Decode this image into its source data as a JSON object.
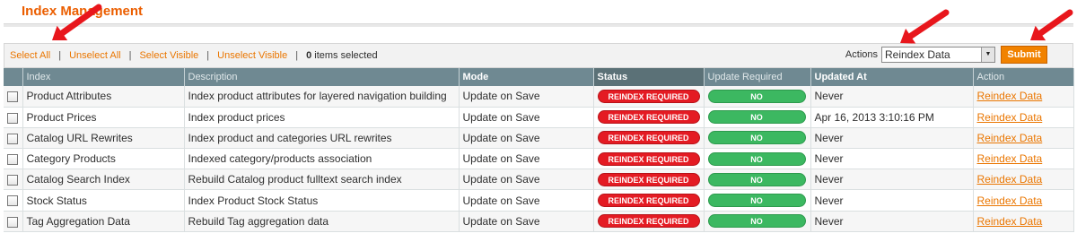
{
  "page": {
    "title": "Index Management"
  },
  "massaction": {
    "select_all": "Select All",
    "unselect_all": "Unselect All",
    "select_visible": "Select Visible",
    "unselect_visible": "Unselect Visible",
    "separator": "|",
    "count": "0",
    "count_suffix": " items selected",
    "actions_label": "Actions",
    "action_selected": "Reindex Data",
    "submit_label": "Submit"
  },
  "grid": {
    "headers": [
      "Index",
      "Description",
      "Mode",
      "Status",
      "Update Required",
      "Updated At",
      "Action"
    ],
    "rows": [
      {
        "index": "Product Attributes",
        "description": "Index product attributes for layered navigation building",
        "mode": "Update on Save",
        "status": "REINDEX REQUIRED",
        "update_required": "NO",
        "updated_at": "Never",
        "action": "Reindex Data"
      },
      {
        "index": "Product Prices",
        "description": "Index product prices",
        "mode": "Update on Save",
        "status": "REINDEX REQUIRED",
        "update_required": "NO",
        "updated_at": "Apr 16, 2013 3:10:16 PM",
        "action": "Reindex Data"
      },
      {
        "index": "Catalog URL Rewrites",
        "description": "Index product and categories URL rewrites",
        "mode": "Update on Save",
        "status": "REINDEX REQUIRED",
        "update_required": "NO",
        "updated_at": "Never",
        "action": "Reindex Data"
      },
      {
        "index": "Category Products",
        "description": "Indexed category/products association",
        "mode": "Update on Save",
        "status": "REINDEX REQUIRED",
        "update_required": "NO",
        "updated_at": "Never",
        "action": "Reindex Data"
      },
      {
        "index": "Catalog Search Index",
        "description": "Rebuild Catalog product fulltext search index",
        "mode": "Update on Save",
        "status": "REINDEX REQUIRED",
        "update_required": "NO",
        "updated_at": "Never",
        "action": "Reindex Data"
      },
      {
        "index": "Stock Status",
        "description": "Index Product Stock Status",
        "mode": "Update on Save",
        "status": "REINDEX REQUIRED",
        "update_required": "NO",
        "updated_at": "Never",
        "action": "Reindex Data"
      },
      {
        "index": "Tag Aggregation Data",
        "description": "Rebuild Tag aggregation data",
        "mode": "Update on Save",
        "status": "REINDEX REQUIRED",
        "update_required": "NO",
        "updated_at": "Never",
        "action": "Reindex Data"
      }
    ]
  },
  "colors": {
    "accent": "#eb5e00",
    "link": "#ea7601",
    "header_bg": "#6f8992",
    "status_red": "#e41b23",
    "status_green": "#3cb861",
    "annotation_arrow": "#e8161c"
  },
  "icons": {
    "dropdown": "chevron-down-icon",
    "annotation": "red-arrow-icon"
  }
}
